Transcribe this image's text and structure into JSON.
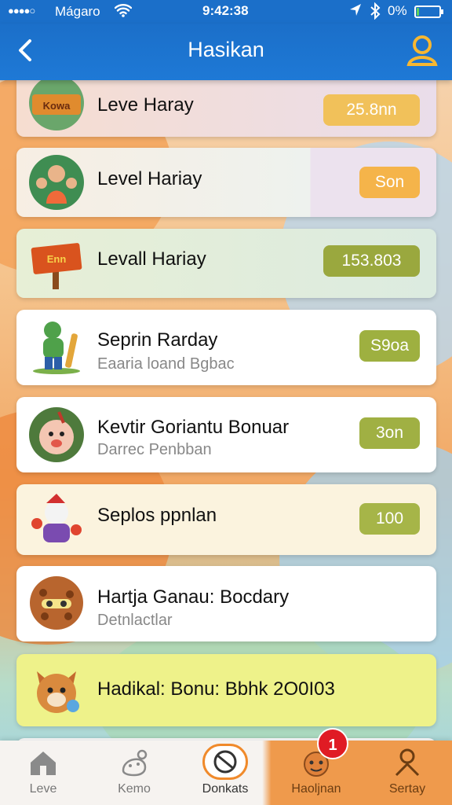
{
  "status_bar": {
    "signal": "●●●●○",
    "carrier": "Mágaro",
    "time": "9:42:38",
    "battery": "0%",
    "battery_level": 0.08,
    "icons": [
      "wifi-icon",
      "location-icon",
      "bluetooth-icon",
      "battery-icon"
    ]
  },
  "navbar": {
    "title": "Hasikan",
    "back_icon": "chevron-left-icon",
    "profile_icon": "user-icon"
  },
  "colors": {
    "nav_blue": "#1b6fc9",
    "badge_orange": "#f1b84a",
    "badge_olive": "#9cab3e",
    "badge_yellow": "#f4b53c",
    "tab_active": "#f08a2b",
    "notif_red": "#e01b24"
  },
  "items": [
    {
      "title": "Leve  Haray",
      "subtitle": "",
      "value": "25.8nn",
      "badge_color": "#f1c15a",
      "avatar_text": "Kowa",
      "avatar_icon": "storybook-icon"
    },
    {
      "title": "Level Hariay",
      "subtitle": "",
      "value": "Son",
      "badge_color": "#f5b44a",
      "avatar_icon": "kids-icon"
    },
    {
      "title": "Levall Hariay",
      "subtitle": "",
      "value": "153.803",
      "badge_color": "#9aa83e",
      "avatar_text": "Enn",
      "avatar_icon": "sign-board-icon"
    },
    {
      "title": "Seprin Rarday",
      "subtitle": "Eaaria loand Bgbac",
      "value": "S9oa",
      "badge_color": "#9eb040",
      "avatar_icon": "cricket-player-icon"
    },
    {
      "title": "Kevtir Goriantu Bonuar",
      "subtitle": "Darrec Penbban",
      "value": "3on",
      "badge_color": "#a0b043",
      "avatar_icon": "cartoon-face-icon"
    },
    {
      "title": "Seplos ppnlan",
      "subtitle": "",
      "value": "100",
      "badge_color": "#a6b548",
      "avatar_icon": "mascot-icon"
    },
    {
      "title": "Hartja Ganau: Bocdary",
      "subtitle": "Detnlactlar",
      "value": "",
      "badge_color": "",
      "avatar_icon": "cookie-face-icon"
    },
    {
      "title": "Hadikal: Bonu: Bbhk 2O0I03",
      "subtitle": "",
      "value": "",
      "badge_color": "",
      "avatar_icon": "fox-icon"
    }
  ],
  "tabs": [
    {
      "label": "Leve",
      "icon": "home-icon"
    },
    {
      "label": "Kemo",
      "icon": "creature-icon"
    },
    {
      "label": "Donkats",
      "icon": "crossed-circle-icon",
      "active": true
    },
    {
      "label": "Haoljnan",
      "icon": "emoji-face-icon",
      "notification": "1"
    },
    {
      "label": "Sertay",
      "icon": "person-icon"
    }
  ]
}
